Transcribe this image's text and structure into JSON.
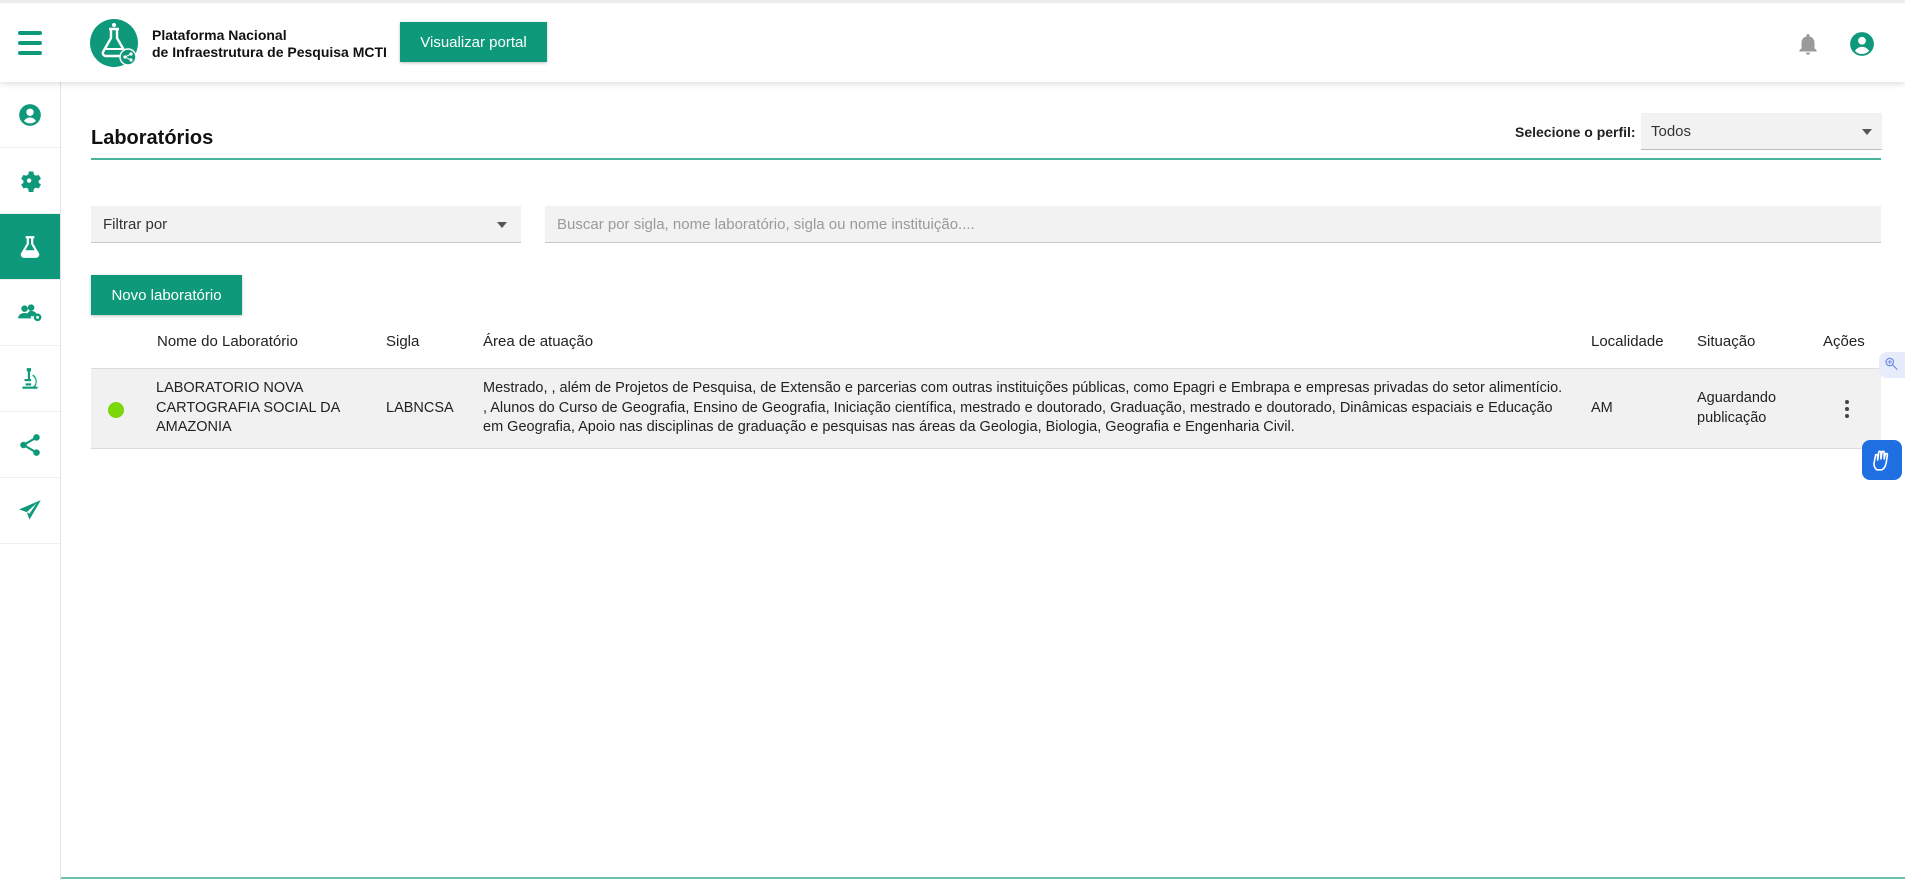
{
  "header": {
    "brand_line1": "Plataforma Nacional",
    "brand_line2": "de Infraestrutura de Pesquisa MCTI",
    "portal_button": "Visualizar portal",
    "accent_color": "#0e9a7a"
  },
  "sidebar": {
    "items": [
      {
        "icon": "user-circle-icon",
        "active": false
      },
      {
        "icon": "gear-icon",
        "active": false
      },
      {
        "icon": "flask-icon",
        "active": true
      },
      {
        "icon": "users-gear-icon",
        "active": false
      },
      {
        "icon": "microscope-icon",
        "active": false
      },
      {
        "icon": "share-icon",
        "active": false
      },
      {
        "icon": "paper-plane-icon",
        "active": false
      }
    ]
  },
  "main": {
    "title": "Laboratórios",
    "perfil_label": "Selecione o perfil:",
    "perfil_value": "Todos",
    "filter_value": "Filtrar por",
    "search_placeholder": "Buscar por sigla, nome laboratório, sigla ou nome instituição....",
    "new_button": "Novo laboratório"
  },
  "table": {
    "columns": [
      "Nome do Laboratório",
      "Sigla",
      "Área de atuação",
      "Localidade",
      "Situação",
      "Ações"
    ],
    "rows": [
      {
        "status_color": "#7bd60a",
        "nome": "LABORATORIO NOVA CARTOGRAFIA SOCIAL DA AMAZONIA",
        "sigla": "LABNCSA",
        "area": "Mestrado, , além de Projetos de Pesquisa, de Extensão e parcerias com outras instituições públicas, como Epagri e Embrapa e empresas privadas do setor alimentício. , Alunos do Curso de Geografia, Ensino de Geografia, Iniciação científica, mestrado e doutorado, Graduação, mestrado e doutorado, Dinâmicas espaciais e Educação em Geografia, Apoio nas disciplinas de graduação e pesquisas nas áreas da Geologia, Biologia, Geografia e Engenharia Civil.",
        "localidade": "AM",
        "situacao": "Aguardando publicação"
      }
    ]
  }
}
